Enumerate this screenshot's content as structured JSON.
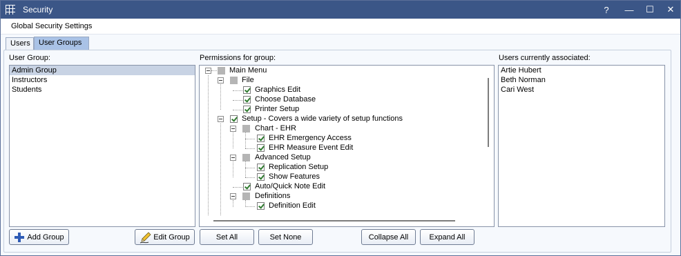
{
  "window": {
    "title": "Security",
    "help_label": "?",
    "minimize_label": "—",
    "maximize_label": "☐",
    "close_label": "✕"
  },
  "menu": {
    "global_security_settings": "Global Security Settings"
  },
  "tabs": [
    {
      "label": "Users",
      "active": false
    },
    {
      "label": "User Groups",
      "active": true
    }
  ],
  "user_group": {
    "label": "User Group:",
    "items": [
      "Admin Group",
      "Instructors",
      "Students"
    ],
    "selected": "Admin Group"
  },
  "permissions": {
    "label": "Permissions for group:",
    "nodes": [
      {
        "label": "Main Menu",
        "state": "mixed"
      },
      {
        "label": "File",
        "state": "mixed"
      },
      {
        "label": "Graphics Edit",
        "state": "checked"
      },
      {
        "label": "Choose Database",
        "state": "checked"
      },
      {
        "label": "Printer Setup",
        "state": "checked"
      },
      {
        "label": "Setup - Covers a wide variety of setup functions",
        "state": "checked"
      },
      {
        "label": "Chart - EHR",
        "state": "mixed"
      },
      {
        "label": "EHR Emergency Access",
        "state": "checked"
      },
      {
        "label": "EHR Measure Event Edit",
        "state": "checked"
      },
      {
        "label": "Advanced Setup",
        "state": "mixed"
      },
      {
        "label": "Replication Setup",
        "state": "checked"
      },
      {
        "label": "Show Features",
        "state": "checked"
      },
      {
        "label": "Auto/Quick Note Edit",
        "state": "checked"
      },
      {
        "label": "Definitions",
        "state": "mixed"
      },
      {
        "label": "Definition Edit",
        "state": "checked"
      }
    ]
  },
  "associated": {
    "label": "Users currently associated:",
    "items": [
      "Artie Hubert",
      "Beth Norman",
      "Cari West"
    ]
  },
  "buttons": {
    "add_group": "Add Group",
    "edit_group": "Edit Group",
    "set_all": "Set All",
    "set_none": "Set None",
    "collapse_all": "Collapse All",
    "expand_all": "Expand All"
  },
  "icons": {
    "app": "grid-app-icon",
    "add": "plus-icon",
    "edit": "pencil-icon"
  },
  "colors": {
    "titlebar": "#3b5687",
    "active_tab": "#a9c2e6",
    "selection": "#c8d3e4",
    "plus_icon": "#2e5bb5"
  }
}
